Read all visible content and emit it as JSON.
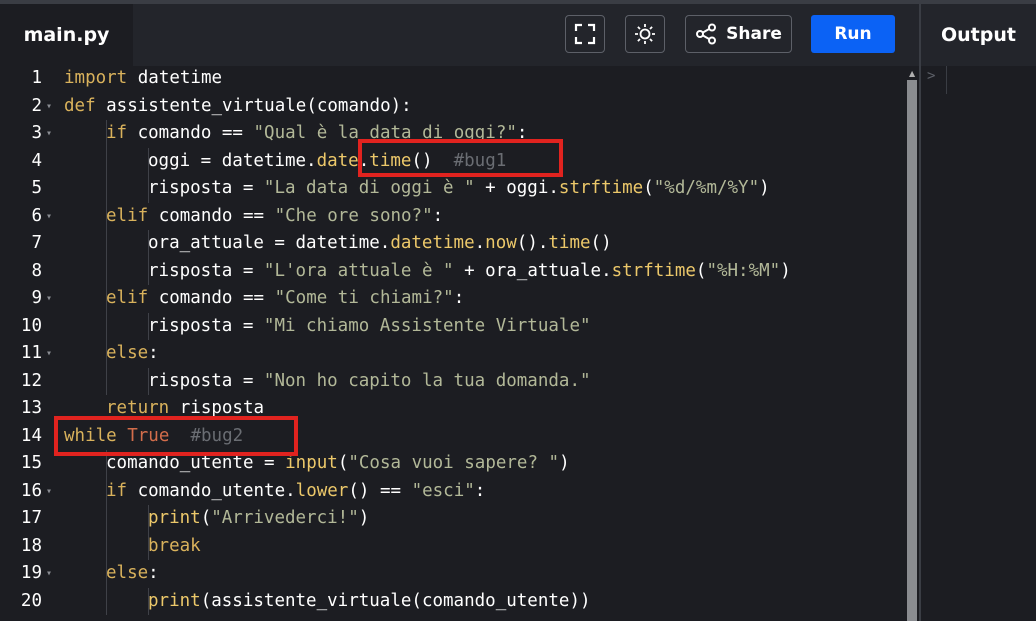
{
  "file_tab": {
    "name": "main.py"
  },
  "toolbar": {
    "fullscreen_icon": "fullscreen-icon",
    "theme_icon": "sun-icon",
    "share_label": "Share",
    "run_label": "Run"
  },
  "output": {
    "title": "Output",
    "prompt": ">"
  },
  "code_lines": [
    {
      "n": "1",
      "fold": false,
      "indent": 0,
      "tokens": [
        [
          "kw",
          "import"
        ],
        [
          "op",
          " datetime"
        ]
      ]
    },
    {
      "n": "2",
      "fold": true,
      "indent": 0,
      "tokens": [
        [
          "kw",
          "def"
        ],
        [
          "op",
          " assistente_virtuale(comando):"
        ]
      ]
    },
    {
      "n": "3",
      "fold": true,
      "indent": 1,
      "tokens": [
        [
          "kw",
          "if"
        ],
        [
          "op",
          " comando == "
        ],
        [
          "str",
          "\"Qual è la data di oggi?\""
        ],
        [
          "op",
          ":"
        ]
      ]
    },
    {
      "n": "4",
      "fold": false,
      "indent": 2,
      "tokens": [
        [
          "op",
          "oggi = datetime."
        ],
        [
          "fn",
          "date"
        ],
        [
          "op",
          "."
        ],
        [
          "fn",
          "time"
        ],
        [
          "op",
          "()  "
        ],
        [
          "cm",
          "#bug1"
        ]
      ]
    },
    {
      "n": "5",
      "fold": false,
      "indent": 2,
      "tokens": [
        [
          "op",
          "risposta = "
        ],
        [
          "str",
          "\"La data di oggi è \""
        ],
        [
          "op",
          " + oggi."
        ],
        [
          "fn",
          "strftime"
        ],
        [
          "op",
          "("
        ],
        [
          "str",
          "\"%d/%m/%Y\""
        ],
        [
          "op",
          ")"
        ]
      ]
    },
    {
      "n": "6",
      "fold": true,
      "indent": 1,
      "tokens": [
        [
          "kw",
          "elif"
        ],
        [
          "op",
          " comando == "
        ],
        [
          "str",
          "\"Che ore sono?\""
        ],
        [
          "op",
          ":"
        ]
      ]
    },
    {
      "n": "7",
      "fold": false,
      "indent": 2,
      "tokens": [
        [
          "op",
          "ora_attuale = datetime."
        ],
        [
          "fn",
          "datetime"
        ],
        [
          "op",
          "."
        ],
        [
          "fn",
          "now"
        ],
        [
          "op",
          "()."
        ],
        [
          "fn",
          "time"
        ],
        [
          "op",
          "()"
        ]
      ]
    },
    {
      "n": "8",
      "fold": false,
      "indent": 2,
      "tokens": [
        [
          "op",
          "risposta = "
        ],
        [
          "str",
          "\"L'ora attuale è \""
        ],
        [
          "op",
          " + ora_attuale."
        ],
        [
          "fn",
          "strftime"
        ],
        [
          "op",
          "("
        ],
        [
          "str",
          "\"%H:%M\""
        ],
        [
          "op",
          ")"
        ]
      ]
    },
    {
      "n": "9",
      "fold": true,
      "indent": 1,
      "tokens": [
        [
          "kw",
          "elif"
        ],
        [
          "op",
          " comando == "
        ],
        [
          "str",
          "\"Come ti chiami?\""
        ],
        [
          "op",
          ":"
        ]
      ]
    },
    {
      "n": "10",
      "fold": false,
      "indent": 2,
      "tokens": [
        [
          "op",
          "risposta = "
        ],
        [
          "str",
          "\"Mi chiamo Assistente Virtuale\""
        ]
      ]
    },
    {
      "n": "11",
      "fold": true,
      "indent": 1,
      "tokens": [
        [
          "kw",
          "else"
        ],
        [
          "op",
          ":"
        ]
      ]
    },
    {
      "n": "12",
      "fold": false,
      "indent": 2,
      "tokens": [
        [
          "op",
          "risposta = "
        ],
        [
          "str",
          "\"Non ho capito la tua domanda.\""
        ]
      ]
    },
    {
      "n": "13",
      "fold": false,
      "indent": 1,
      "tokens": [
        [
          "kw",
          "return"
        ],
        [
          "op",
          " risposta"
        ]
      ]
    },
    {
      "n": "14",
      "fold": false,
      "indent": 0,
      "tokens": [
        [
          "kw",
          "while"
        ],
        [
          "op",
          " "
        ],
        [
          "tru",
          "True"
        ],
        [
          "op",
          "  "
        ],
        [
          "cm",
          "#bug2"
        ]
      ]
    },
    {
      "n": "15",
      "fold": false,
      "indent": 1,
      "tokens": [
        [
          "op",
          "comando_utente = "
        ],
        [
          "fn",
          "input"
        ],
        [
          "op",
          "("
        ],
        [
          "str",
          "\"Cosa vuoi sapere? \""
        ],
        [
          "op",
          ")"
        ]
      ]
    },
    {
      "n": "16",
      "fold": true,
      "indent": 1,
      "tokens": [
        [
          "kw",
          "if"
        ],
        [
          "op",
          " comando_utente."
        ],
        [
          "fn",
          "lower"
        ],
        [
          "op",
          "() == "
        ],
        [
          "str",
          "\"esci\""
        ],
        [
          "op",
          ":"
        ]
      ]
    },
    {
      "n": "17",
      "fold": false,
      "indent": 2,
      "tokens": [
        [
          "fn",
          "print"
        ],
        [
          "op",
          "("
        ],
        [
          "str",
          "\"Arrivederci!\""
        ],
        [
          "op",
          ")"
        ]
      ]
    },
    {
      "n": "18",
      "fold": false,
      "indent": 2,
      "tokens": [
        [
          "kw",
          "break"
        ]
      ]
    },
    {
      "n": "19",
      "fold": true,
      "indent": 1,
      "tokens": [
        [
          "kw",
          "else"
        ],
        [
          "op",
          ":"
        ]
      ]
    },
    {
      "n": "20",
      "fold": false,
      "indent": 2,
      "tokens": [
        [
          "fn",
          "print"
        ],
        [
          "op",
          "(assistente_virtuale(comando_utente))"
        ]
      ]
    }
  ],
  "colors": {
    "keyword": "#d9b25c",
    "string": "#b2b898",
    "function": "#ecc86a",
    "comment": "#6a6d73",
    "boolean": "#d36d4b",
    "highlight_box": "#e1231f",
    "run_button": "#0b62f5"
  }
}
